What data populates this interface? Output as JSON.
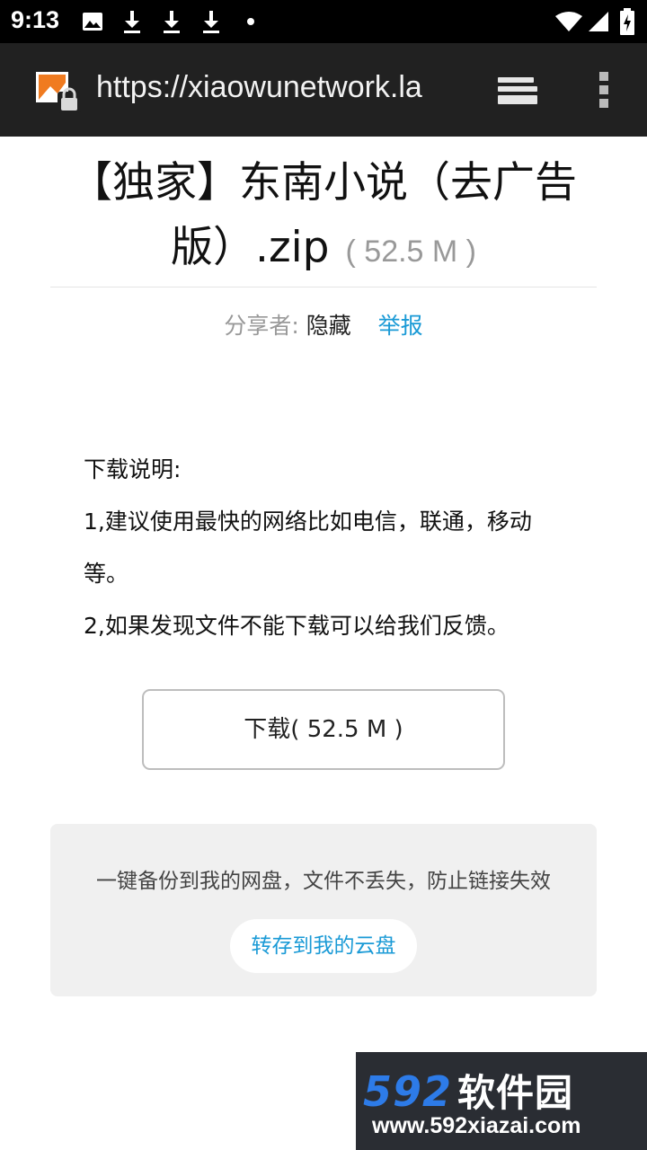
{
  "status_bar": {
    "time": "9:13",
    "icons": [
      "image-icon",
      "download-icon",
      "download-icon",
      "download-icon",
      "dot-icon",
      "wifi-icon",
      "signal-icon",
      "battery-charging-icon"
    ]
  },
  "toolbar": {
    "url": "https://xiaowunetwork.la",
    "icons": [
      "insecure-site-lock-icon",
      "tabs-icon",
      "overflow-menu-icon"
    ]
  },
  "file": {
    "title": "【独家】东南小说（去广告版）.zip",
    "size": "( 52.5 M )"
  },
  "share": {
    "label": "分享者:",
    "value": "隐藏",
    "report": "举报"
  },
  "instructions": {
    "heading": "下载说明:",
    "line1": "1,建议使用最快的网络比如电信，联通，移动等。",
    "line2": "2,如果发现文件不能下载可以给我们反馈。"
  },
  "download_button": "下载( 52.5 M )",
  "backup": {
    "text": "一键备份到我的网盘，文件不丢失，防止链接失效",
    "button": "转存到我的云盘"
  },
  "watermark": {
    "logo_number": "592",
    "logo_text": "软件园",
    "url": "www.592xiazai.com"
  },
  "colors": {
    "link": "#1a9ad6",
    "toolbar_bg": "#212121",
    "status_bg": "#000000",
    "watermark_blue": "#2d7be8"
  }
}
